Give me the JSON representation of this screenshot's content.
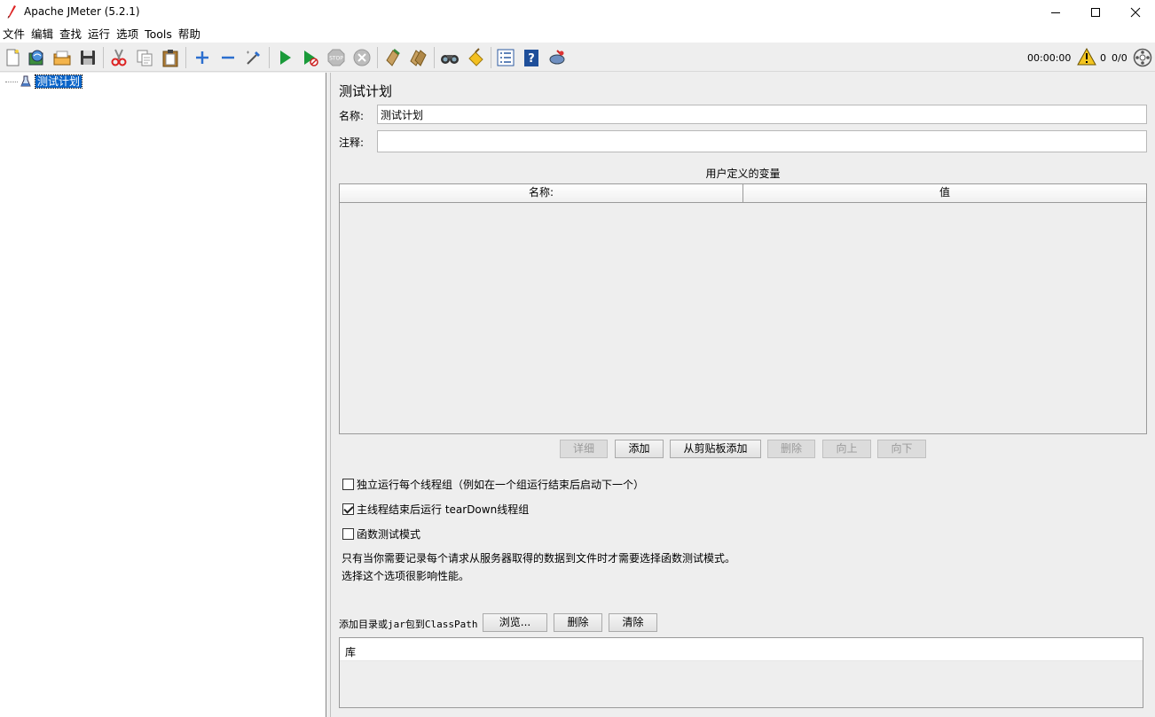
{
  "window": {
    "title": "Apache JMeter (5.2.1)"
  },
  "menu": [
    "文件",
    "编辑",
    "查找",
    "运行",
    "选项",
    "Tools",
    "帮助"
  ],
  "toolbar": {
    "icons": [
      "new-icon",
      "templates-icon",
      "open-icon",
      "save-icon",
      "cut-icon",
      "copy-icon",
      "paste-icon",
      "expand-icon",
      "collapse-icon",
      "toggle-icon",
      "start-icon",
      "start-no-pauses-icon",
      "stop-icon",
      "shutdown-icon",
      "clear-icon",
      "clear-all-icon",
      "search-icon",
      "reset-search-icon",
      "function-helper-icon",
      "help-icon",
      "remote-start-icon"
    ],
    "timer": "00:00:00",
    "error_count": "0",
    "threads": "0/0"
  },
  "tree": {
    "root_label": "测试计划"
  },
  "panel": {
    "title": "测试计划",
    "name_label": "名称:",
    "name_value": "测试计划",
    "comment_label": "注释:",
    "comment_value": "",
    "vars_title": "用户定义的变量",
    "vars_columns": [
      "名称:",
      "值"
    ],
    "buttons": {
      "detail": "详细",
      "add": "添加",
      "add_from_clipboard": "从剪贴板添加",
      "delete": "删除",
      "up": "向上",
      "down": "向下"
    },
    "checks": {
      "serialize": "独立运行每个线程组（例如在一个组运行结束后启动下一个）",
      "teardown": "主线程结束后运行 tearDown线程组",
      "functional": "函数测试模式"
    },
    "note_line1": "只有当你需要记录每个请求从服务器取得的数据到文件时才需要选择函数测试模式。",
    "note_line2": "选择这个选项很影响性能。",
    "classpath_label": "添加目录或jar包到ClassPath",
    "browse": "浏览...",
    "cp_delete": "删除",
    "cp_clear": "清除",
    "lib_header": "库"
  }
}
